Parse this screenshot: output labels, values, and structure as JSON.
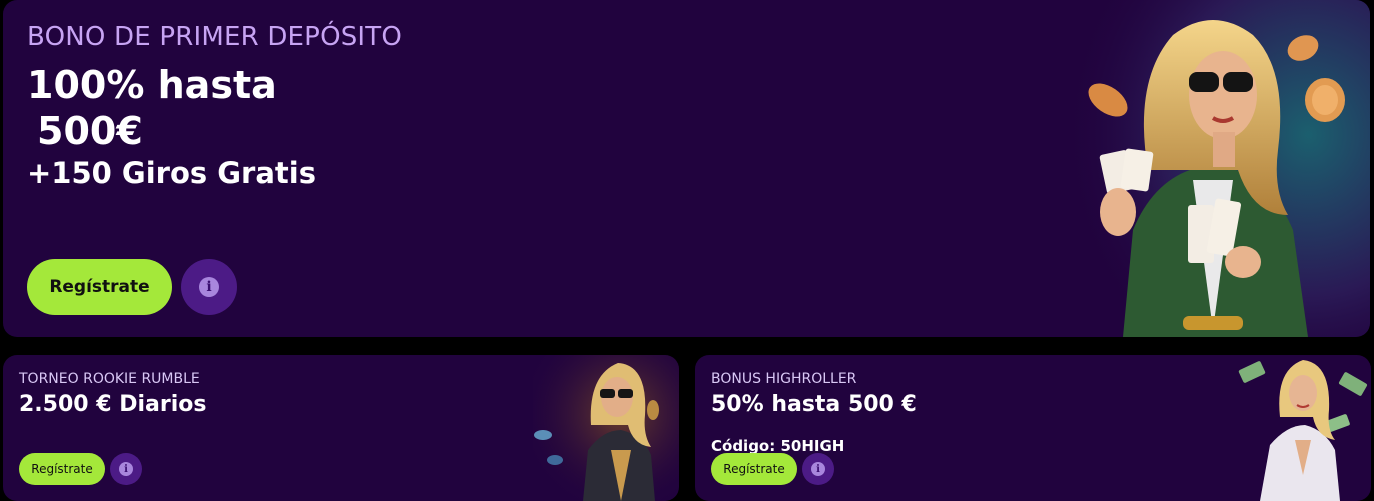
{
  "hero": {
    "eyebrow": "BONO DE PRIMER DEPÓSITO",
    "line1": "100% hasta",
    "line2": "500€",
    "line3": "+150 Giros Gratis",
    "cta_label": "Regístrate",
    "info_icon": "i"
  },
  "cards": [
    {
      "eyebrow": "TORNEO ROOKIE RUMBLE",
      "title": "2.500 € Diarios",
      "cta_label": "Regístrate",
      "info_icon": "i"
    },
    {
      "eyebrow": "BONUS HIGHROLLER",
      "title": "50% hasta 500 €",
      "code": "Código: 50HIGH",
      "cta_label": "Regístrate",
      "info_icon": "i"
    }
  ],
  "colors": {
    "card_bg": "#21033e",
    "cta_green": "#a4e83a",
    "info_purple": "#4c1b86",
    "eyebrow_lilac": "#c7a4f3"
  }
}
